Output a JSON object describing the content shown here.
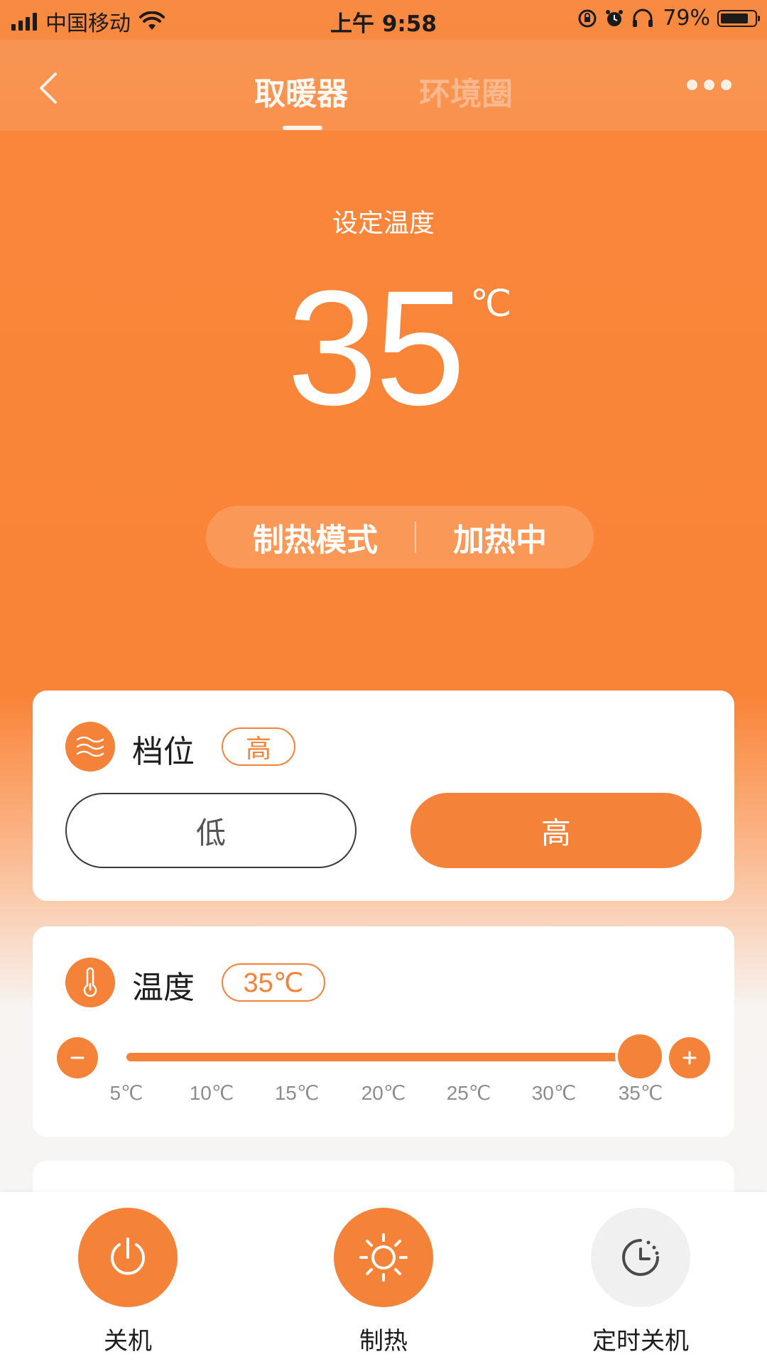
{
  "status_bar": {
    "carrier": "中国移动",
    "time": "上午 9:58",
    "battery": "79%"
  },
  "nav": {
    "tabs": [
      {
        "label": "取暖器",
        "active": true
      },
      {
        "label": "环境圈",
        "active": false
      }
    ]
  },
  "hero": {
    "label": "设定温度",
    "temperature": "35",
    "unit": "℃",
    "mode": "制热模式",
    "state": "加热中"
  },
  "gear_card": {
    "title": "档位",
    "badge": "高",
    "options": [
      "低",
      "高"
    ],
    "selected": "高"
  },
  "temp_card": {
    "title": "温度",
    "badge": "35℃",
    "slider_value": 35,
    "slider_min": 5,
    "slider_max": 35,
    "ticks": [
      "5℃",
      "10℃",
      "15℃",
      "20℃",
      "25℃",
      "30℃",
      "35℃"
    ]
  },
  "actions": [
    {
      "label": "关机",
      "icon": "power-icon",
      "active": true
    },
    {
      "label": "制热",
      "icon": "sun-icon",
      "active": true
    },
    {
      "label": "定时关机",
      "icon": "timer-icon",
      "active": false
    }
  ],
  "colors": {
    "accent": "#f58239",
    "hero_bg": "#f98438",
    "text_dark": "#1d1d1d"
  }
}
